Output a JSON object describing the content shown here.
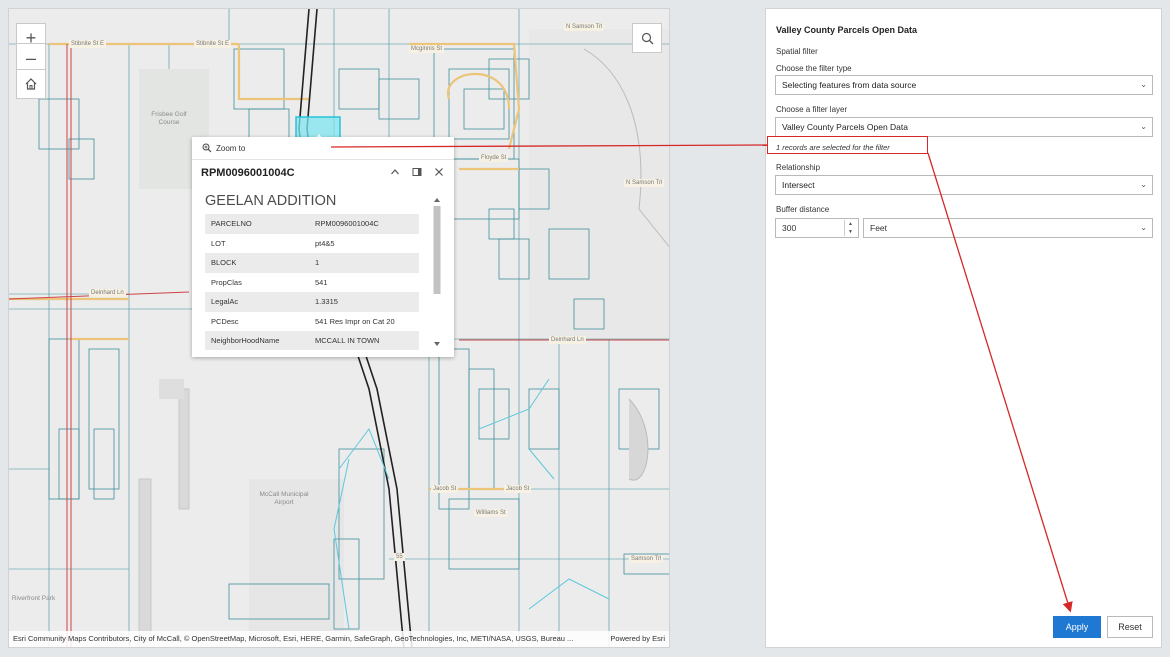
{
  "map": {
    "zoom_in_label": "+",
    "zoom_out_label": "–",
    "home_icon": "home-icon",
    "search_icon": "search-icon",
    "attribution": "Esri Community Maps Contributors, City of McCall, © OpenStreetMap, Microsoft, Esri, HERE, Garmin, SafeGraph, GeoTechnologies, Inc, METI/NASA, USGS, Bureau ...",
    "powered_by": "Powered by Esri",
    "place_labels": {
      "frisbee": "Frisbee Golf Course",
      "airport": "McCall Municipal Airport",
      "riverfront": "Riverfront Park"
    },
    "road_labels": {
      "stibnite1": "Stibnite St E",
      "stibnite2": "Stibnite St E",
      "mcginnis": "Mcginnis St",
      "samson": "N Samson Trl",
      "samson2": "N Samson Trl",
      "floyde": "Floyde St",
      "deinhard_w": "Deinhard Ln",
      "deinhard_e": "Deinhard Ln",
      "jacob": "Jacob St",
      "jacob2": "Jacob St",
      "williams": "Williams St",
      "samson_s": "Samson Trl",
      "highway": "55"
    }
  },
  "popup": {
    "zoom_to": "Zoom to",
    "title": "RPM0096001004C",
    "heading": "GEELAN ADDITION",
    "rows": [
      {
        "field": "PARCELNO",
        "value": "RPM0096001004C"
      },
      {
        "field": "LOT",
        "value": "pt4&5"
      },
      {
        "field": "BLOCK",
        "value": "1"
      },
      {
        "field": "PropClas",
        "value": "541"
      },
      {
        "field": "LegalAc",
        "value": "1.3315"
      },
      {
        "field": "PCDesc",
        "value": "541 Res Impr on Cat 20"
      },
      {
        "field": "NeighborHoodName",
        "value": "MCCALL IN TOWN"
      }
    ]
  },
  "panel": {
    "title": "Valley County Parcels Open Data",
    "spatial_filter": "Spatial filter",
    "filter_type_label": "Choose the filter type",
    "filter_type_value": "Selecting features from data source",
    "filter_layer_label": "Choose a filter layer",
    "filter_layer_value": "Valley County Parcels Open Data",
    "selected_note": "1 records are selected for the filter",
    "relationship_label": "Relationship",
    "relationship_value": "Intersect",
    "buffer_label": "Buffer distance",
    "buffer_value": "300",
    "buffer_unit": "Feet",
    "apply": "Apply",
    "reset": "Reset"
  },
  "colors": {
    "accent": "#1f78d1",
    "annotation": "#d62828",
    "selected_parcel": "#7fe6f0",
    "parcel_line": "#3f8f9a"
  }
}
